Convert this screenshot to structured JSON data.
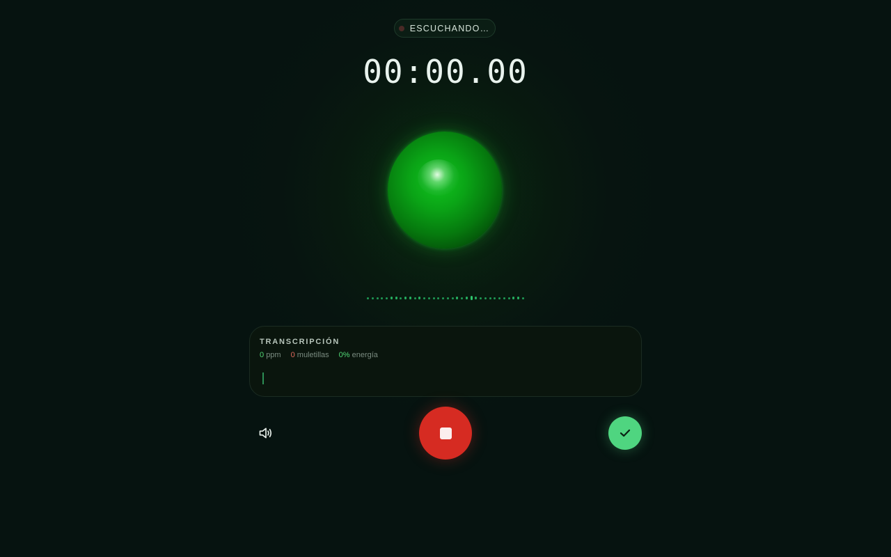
{
  "status": {
    "label": "ESCUCHANDO…",
    "dot_color": "#4a2a26"
  },
  "timer": {
    "value": "00:00.00"
  },
  "orb": {
    "color": "#0aa416"
  },
  "transcription": {
    "title": "TRANSCRIPCIÓN",
    "stats": {
      "ppm_value": "0",
      "ppm_label": "ppm",
      "fillers_value": "0",
      "fillers_label": "muletillas",
      "energy_value": "0%",
      "energy_label": "energía"
    },
    "text": ""
  },
  "controls": {
    "speaker_icon": "speaker-icon",
    "stop_icon": "stop-icon",
    "confirm_icon": "check-icon",
    "stop_color": "#d62b22",
    "confirm_color": "#4fd580"
  }
}
